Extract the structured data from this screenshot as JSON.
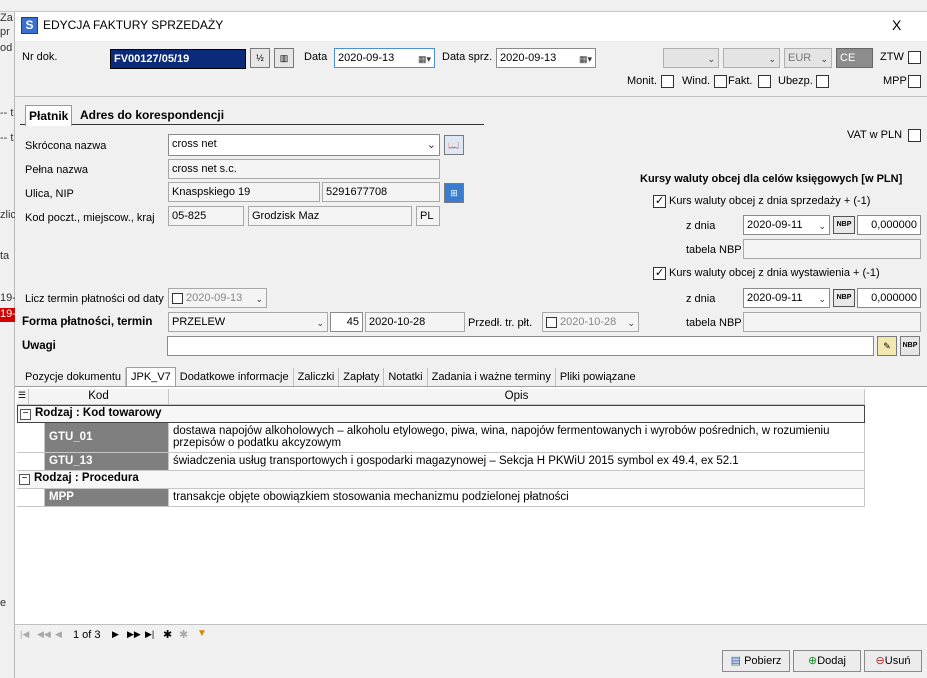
{
  "window": {
    "title": "EDYCJA FAKTURY SPRZEDAŻY",
    "close": "X"
  },
  "background_fragments": [
    "Za",
    "pr",
    "od",
    "-- t",
    "-- t",
    "zlic",
    "ta",
    "19-",
    "19-",
    "e"
  ],
  "header": {
    "nr_dok_label": "Nr dok.",
    "nr_dok_value": "FV00127/05/19",
    "data_label": "Data",
    "data_value": "2020-09-13",
    "data_sprz_label": "Data sprz.",
    "data_sprz_value": "2020-09-13",
    "currency": "EUR",
    "ce": "CE",
    "ztw_label": "ZTW",
    "mpp_label": "MPP",
    "checks": [
      {
        "label": "Monit.",
        "checked": false
      },
      {
        "label": "Wind.",
        "checked": false
      },
      {
        "label": "Fakt.",
        "checked": false
      },
      {
        "label": "Ubezp.",
        "checked": false
      }
    ]
  },
  "tabs_top": {
    "platnik": "Płatnik",
    "adres": "Adres do korespondencji"
  },
  "payer": {
    "short_name_label": "Skrócona nazwa",
    "short_name": "cross net",
    "full_name_label": "Pełna nazwa",
    "full_name": "cross net s.c.",
    "street_label": "Ulica, NIP",
    "street": "Knaspskiego 19",
    "nip": "5291677708",
    "postcode_label": "Kod poczt., miejscow., kraj",
    "postcode": "05-825",
    "city": "Grodzisk Maz",
    "country": "PL",
    "term_from_label": "Licz termin płatności od daty",
    "term_from_date": "2020-09-13",
    "payment_label": "Forma płatności, termin",
    "payment_form": "PRZELEW",
    "payment_days": "45",
    "payment_date": "2020-10-28",
    "predl_label": "Przedł. tr. płt.",
    "predl_date": "2020-10-28",
    "notes_label": "Uwagi",
    "notes_value": ""
  },
  "right": {
    "vat_label": "VAT w PLN",
    "kursy_title": "Kursy waluty obcej dla celów księgowych [w PLN]",
    "kurs1_label": "Kurs waluty obcej z dnia sprzedaży + (-1)",
    "kurs2_label": "Kurs waluty obcej z dnia wystawienia + (-1)",
    "z_dnia_label": "z dnia",
    "tabela_label": "tabela NBP",
    "kurs1_date": "2020-09-11",
    "kurs1_value": "0,000000",
    "kurs2_date": "2020-09-11",
    "kurs2_value": "0,000000",
    "nbp": "NBP"
  },
  "tabs_bottom": [
    "Pozycje dokumentu",
    "JPK_V7",
    "Dodatkowe informacje",
    "Zaliczki",
    "Zapłaty",
    "Notatki",
    "Zadania i ważne terminy",
    "Pliki powiązane"
  ],
  "grid": {
    "columns": {
      "kod": "Kod",
      "opis": "Opis"
    },
    "groups": [
      {
        "label": "Rodzaj : Kod towarowy",
        "rows": [
          {
            "kod": "GTU_01",
            "opis": "dostawa napojów alkoholowych – alkoholu etylowego, piwa, wina, napojów fermentowanych i wyrobów pośrednich, w rozumieniu przepisów o podatku akcyzowym"
          },
          {
            "kod": "GTU_13",
            "opis": "świadczenia usług transportowych i gospodarki magazynowej – Sekcja H PKWiU 2015 symbol ex 49.4, ex 52.1"
          }
        ]
      },
      {
        "label": "Rodzaj : Procedura",
        "rows": [
          {
            "kod": "MPP",
            "opis": "transakcje objęte obowiązkiem stosowania mechanizmu podzielonej płatności"
          }
        ]
      }
    ]
  },
  "pager": {
    "text": "1 of 3"
  },
  "buttons": {
    "pobierz": "Pobierz",
    "dodaj": "Dodaj",
    "usun": "Usuń"
  },
  "colors": {
    "navy": "#0b2a7a",
    "kod_cell": "#7f7f7f",
    "panel": "#f0f0f0"
  }
}
